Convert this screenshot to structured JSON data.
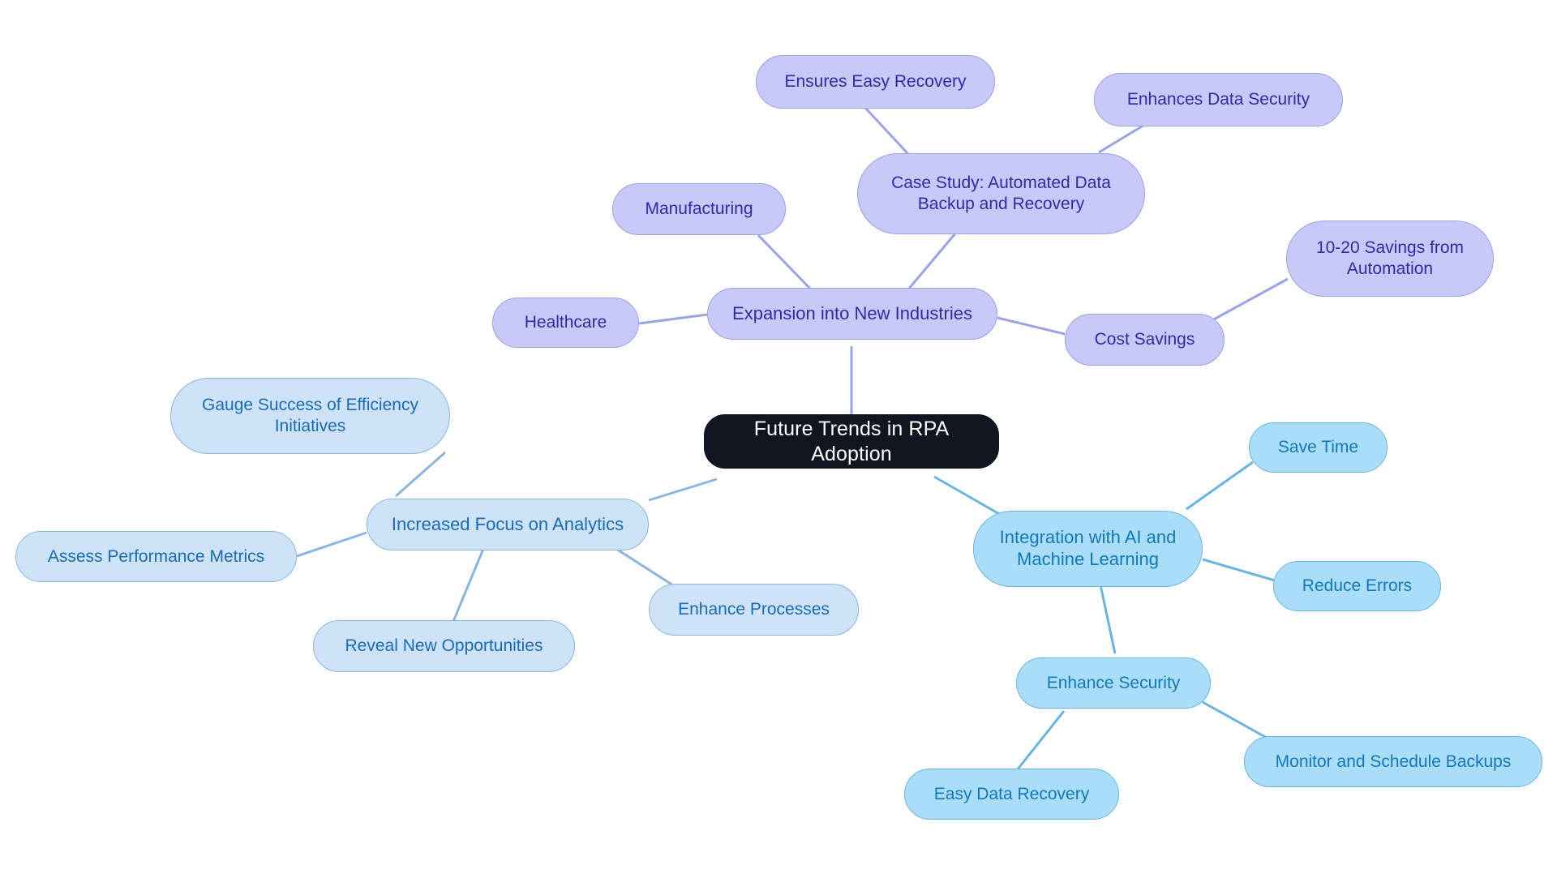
{
  "diagram": {
    "type": "mindmap",
    "title": "Future Trends in RPA Adoption",
    "background_color": "#ffffff",
    "palette": {
      "root_fill": "#11151f",
      "root_text": "#ffffff",
      "purple_fill": "#c7caf8",
      "purple_border": "#9ba2e8",
      "purple_text": "#2e2aa8",
      "blue_fill": "#cfe3f8",
      "blue_border": "#8ab6de",
      "blue_text": "#176bb8",
      "cyan_fill": "#aaddf8",
      "cyan_border": "#68b6e0",
      "cyan_text": "#1179bb"
    }
  },
  "root": {
    "label": "Future Trends in RPA Adoption"
  },
  "branches": [
    {
      "id": "expansion",
      "label": "Expansion into New Industries",
      "color": "purple",
      "children": [
        {
          "id": "healthcare",
          "label": "Healthcare"
        },
        {
          "id": "manufacturing",
          "label": "Manufacturing"
        },
        {
          "id": "case-study",
          "label": "Case Study: Automated Data\nBackup and Recovery"
        },
        {
          "id": "cost-savings",
          "label": "Cost Savings"
        }
      ]
    },
    {
      "id": "analytics",
      "label": "Increased Focus on Analytics",
      "color": "blue",
      "children": [
        {
          "id": "gauge-success",
          "label": "Gauge Success of Efficiency\nInitiatives"
        },
        {
          "id": "assess-metrics",
          "label": "Assess Performance Metrics"
        },
        {
          "id": "reveal-opportunities",
          "label": "Reveal New Opportunities"
        },
        {
          "id": "enhance-processes",
          "label": "Enhance Processes"
        }
      ]
    },
    {
      "id": "ai-ml",
      "label": "Integration with AI and\nMachine Learning",
      "color": "cyan",
      "children": [
        {
          "id": "save-time",
          "label": "Save Time"
        },
        {
          "id": "reduce-errors",
          "label": "Reduce Errors"
        },
        {
          "id": "enhance-security",
          "label": "Enhance Security"
        }
      ]
    }
  ],
  "sub_leaves": [
    {
      "id": "ensures-easy-recovery",
      "label": "Ensures Easy Recovery",
      "parent": "case-study",
      "color": "purple"
    },
    {
      "id": "enhances-data-security",
      "label": "Enhances Data Security",
      "parent": "case-study",
      "color": "purple"
    },
    {
      "id": "savings-from-automation",
      "label": "10-20 Savings from\nAutomation",
      "parent": "cost-savings",
      "color": "purple"
    },
    {
      "id": "easy-data-recovery",
      "label": "Easy Data Recovery",
      "parent": "enhance-security",
      "color": "cyan"
    },
    {
      "id": "monitor-schedule-backups",
      "label": "Monitor and Schedule Backups",
      "parent": "enhance-security",
      "color": "cyan"
    }
  ]
}
